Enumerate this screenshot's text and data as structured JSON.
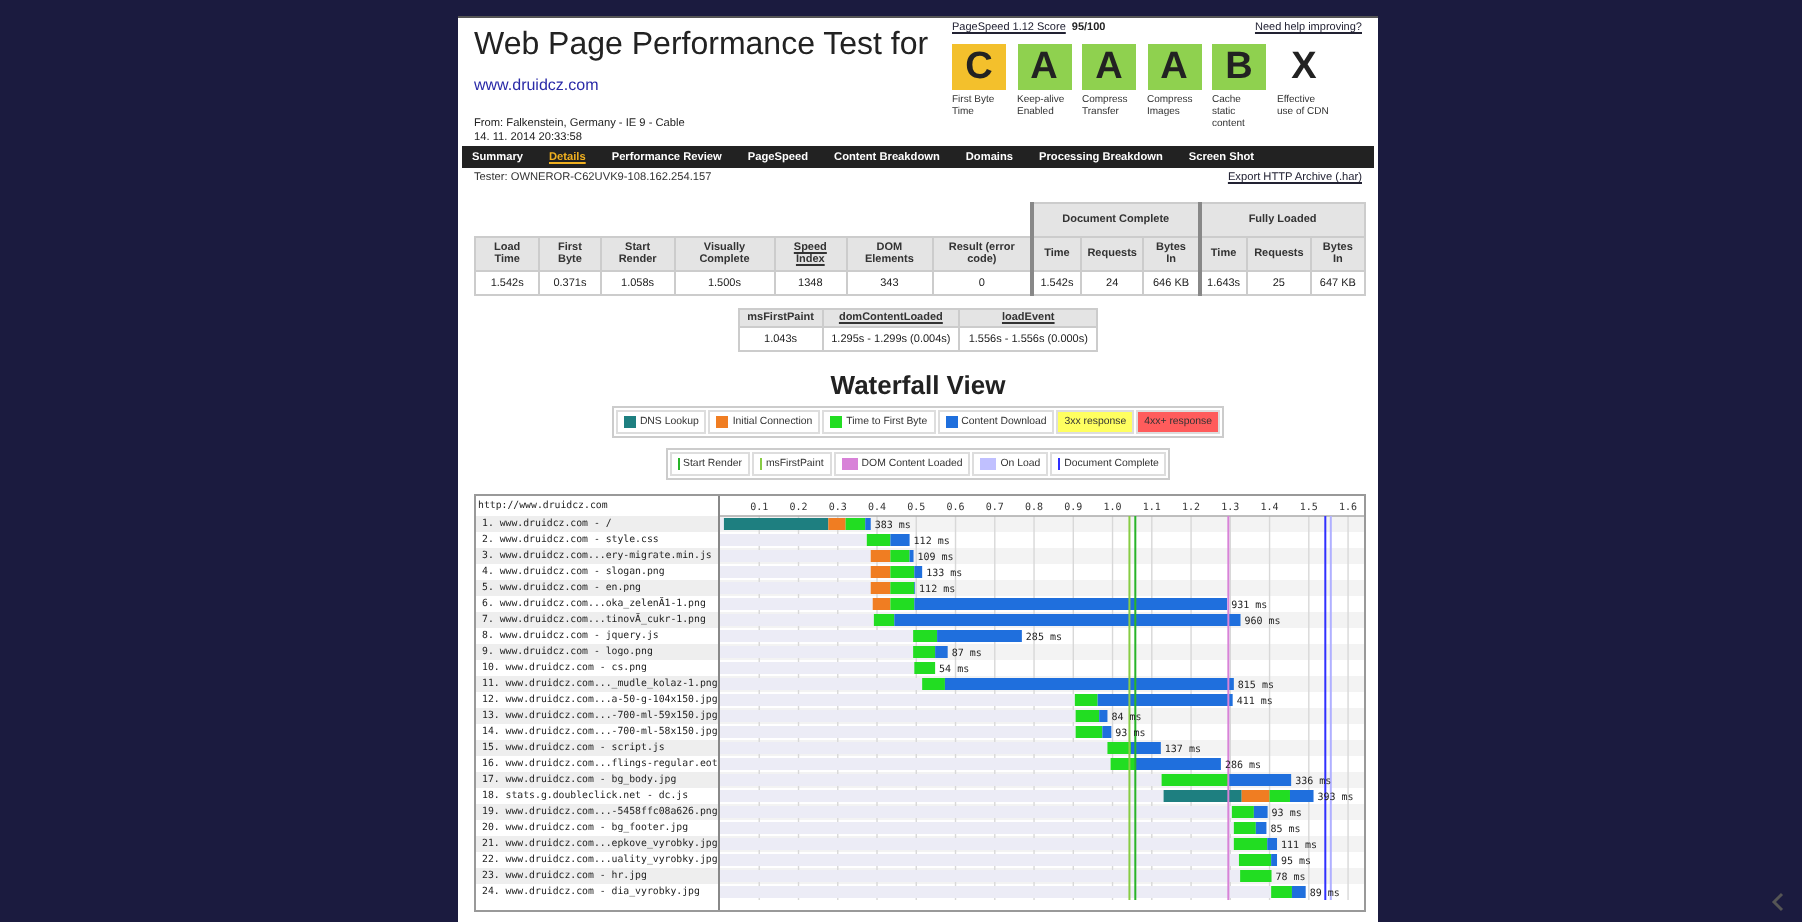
{
  "header": {
    "title": "Web Page Performance Test for",
    "url": "www.druidcz.com",
    "from": "From: Falkenstein, Germany - IE 9 - Cable",
    "date": "14. 11. 2014 20:33:58",
    "pagespeed_link": "PageSpeed 1.12 Score",
    "pagespeed_score": "95/100",
    "help_link": "Need help improving?"
  },
  "grades": [
    {
      "grade": "C",
      "label": "First Byte Time",
      "color": "#f3c02c"
    },
    {
      "grade": "A",
      "label": "Keep-alive Enabled",
      "color": "#8fd14f"
    },
    {
      "grade": "A",
      "label": "Compress Transfer",
      "color": "#8fd14f"
    },
    {
      "grade": "A",
      "label": "Compress Images",
      "color": "#8fd14f"
    },
    {
      "grade": "B",
      "label": "Cache static content",
      "color": "#8fd14f"
    },
    {
      "grade": "X",
      "label": "Effective use of CDN",
      "color": "#ffffff"
    }
  ],
  "nav": [
    {
      "label": "Summary",
      "selected": false
    },
    {
      "label": "Details",
      "selected": true
    },
    {
      "label": "Performance Review",
      "selected": false
    },
    {
      "label": "PageSpeed",
      "selected": false
    },
    {
      "label": "Content Breakdown",
      "selected": false
    },
    {
      "label": "Domains",
      "selected": false
    },
    {
      "label": "Processing Breakdown",
      "selected": false
    },
    {
      "label": "Screen Shot",
      "selected": false
    }
  ],
  "tester": "Tester: OWNEROR-C62UVK9-108.162.254.157",
  "export_link": "Export HTTP Archive (.har)",
  "summary_table": {
    "columns": [
      {
        "label": "Load Time",
        "link": false
      },
      {
        "label": "First Byte",
        "link": false
      },
      {
        "label": "Start Render",
        "link": false
      },
      {
        "label": "Visually Complete",
        "link": false
      },
      {
        "label": "Speed Index",
        "link": true
      },
      {
        "label": "DOM Elements",
        "link": false
      },
      {
        "label": "Result (error code)",
        "link": false
      }
    ],
    "groups": [
      {
        "label": "Document Complete",
        "columns": [
          "Time",
          "Requests",
          "Bytes In"
        ]
      },
      {
        "label": "Fully Loaded",
        "columns": [
          "Time",
          "Requests",
          "Bytes In"
        ]
      }
    ],
    "row": [
      "1.542s",
      "0.371s",
      "1.058s",
      "1.500s",
      "1348",
      "343",
      "0",
      "1.542s",
      "24",
      "646 KB",
      "1.643s",
      "25",
      "647 KB"
    ]
  },
  "timing_table": {
    "columns": [
      {
        "label": "msFirstPaint",
        "link": false
      },
      {
        "label": "domContentLoaded",
        "link": true
      },
      {
        "label": "loadEvent",
        "link": true
      }
    ],
    "row": [
      "1.043s",
      "1.295s - 1.299s (0.004s)",
      "1.556s - 1.556s (0.000s)"
    ]
  },
  "waterfall": {
    "title": "Waterfall View",
    "legend": [
      {
        "label": "3xx response",
        "color": "#ffff60"
      },
      {
        "label": "4xx+ response",
        "color": "#ff5c5c"
      }
    ],
    "markers": [
      {
        "label": "Start Render",
        "color": "#28b428",
        "kind": "line"
      },
      {
        "label": "msFirstPaint",
        "color": "#88cc44",
        "kind": "line"
      },
      {
        "label": "DOM Content Loaded",
        "color": "#d882d8",
        "kind": "box"
      },
      {
        "label": "On Load",
        "color": "#c0c0ff",
        "kind": "box"
      },
      {
        "label": "Document Complete",
        "color": "#3030ff",
        "kind": "line"
      }
    ],
    "header": "http://www.druidcz.com",
    "chart_data": {
      "type": "bar",
      "orientation": "horizontal",
      "stacked": true,
      "categories": [
        "1. www.druidcz.com - /",
        "2. www.druidcz.com - style.css",
        "3. www.druidcz.com...ery-migrate.min.js",
        "4. www.druidcz.com - slogan.png",
        "5. www.druidcz.com - en.png",
        "6. www.druidcz.com...oka_zelenÃ1-1.png",
        "7. www.druidcz.com...tinovÃ_cukr-1.png",
        "8. www.druidcz.com - jquery.js",
        "9. www.druidcz.com - logo.png",
        "10. www.druidcz.com - cs.png",
        "11. www.druidcz.com..._mudle_kolaz-1.png",
        "12. www.druidcz.com...a-50-g-104x150.jpg",
        "13. www.druidcz.com...-700-ml-59x150.jpg",
        "14. www.druidcz.com...-700-ml-58x150.jpg",
        "15. www.druidcz.com - script.js",
        "16. www.druidcz.com...flings-regular.eot",
        "17. www.druidcz.com - bg_body.jpg",
        "18. stats.g.doubleclick.net - dc.js",
        "19. www.druidcz.com...-5458ffc08a626.png",
        "20. www.druidcz.com - bg_footer.jpg",
        "21. www.druidcz.com...epkove_vyrobky.jpg",
        "22. www.druidcz.com...uality_vyrobky.jpg",
        "23. www.druidcz.com - hr.jpg",
        "24. www.druidcz.com - dia_vyrobky.jpg"
      ],
      "series": [
        {
          "color": "#ececf6",
          "values": [
            0.01,
            0.374,
            0.384,
            0.384,
            0.384,
            0.389,
            0.392,
            0.492,
            0.492,
            0.495,
            0.515,
            0.904,
            0.906,
            0.906,
            0.987,
            0.995,
            1.125,
            1.13,
            1.304,
            1.309,
            1.309,
            1.322,
            1.325,
            1.404
          ]
        },
        {
          "name": "DNS Lookup",
          "color": "#1e7f80",
          "values": [
            0.266,
            0,
            0,
            0,
            0,
            0,
            0,
            0,
            0,
            0,
            0,
            0,
            0,
            0,
            0,
            0,
            0,
            0.199,
            0,
            0,
            0,
            0,
            0,
            0
          ]
        },
        {
          "name": "Initial Connection",
          "color": "#f07d22",
          "values": [
            0.044,
            0,
            0.05,
            0.05,
            0.05,
            0.045,
            0,
            0,
            0,
            0,
            0,
            0,
            0,
            0,
            0,
            0,
            0,
            0.071,
            0,
            0,
            0,
            0,
            0,
            0
          ]
        },
        {
          "name": "Time to First Byte",
          "color": "#22dd22",
          "values": [
            0.05,
            0.06,
            0.049,
            0.061,
            0.061,
            0.061,
            0.052,
            0.061,
            0.056,
            0.053,
            0.058,
            0.058,
            0.06,
            0.068,
            0.06,
            0.062,
            0.169,
            0.052,
            0.056,
            0.056,
            0.085,
            0.082,
            0.08,
            0.053
          ]
        },
        {
          "name": "Content Download",
          "color": "#1f6fdd",
          "values": [
            0.014,
            0.049,
            0.01,
            0.02,
            0.002,
            0.797,
            0.882,
            0.216,
            0.032,
            0,
            0.736,
            0.344,
            0.021,
            0.023,
            0.076,
            0.219,
            0.161,
            0.06,
            0.035,
            0.027,
            0.025,
            0.015,
            0,
            0.035
          ]
        }
      ],
      "value_labels": [
        "383 ms",
        "112 ms",
        "109 ms",
        "133 ms",
        "112 ms",
        "931 ms",
        "960 ms",
        "285 ms",
        "87 ms",
        "54 ms",
        "815 ms",
        "411 ms",
        "84 ms",
        "93 ms",
        "137 ms",
        "286 ms",
        "336 ms",
        "393 ms",
        "93 ms",
        "85 ms",
        "111 ms",
        "95 ms",
        "78 ms",
        "89 ms"
      ],
      "xlim": [
        0,
        1.61
      ],
      "xticks": [
        0.1,
        0.2,
        0.3,
        0.4,
        0.5,
        0.6,
        0.7,
        0.8,
        0.9,
        {
          "value": 1,
          "label": "1.0"
        },
        1.1,
        1.2,
        1.3,
        1.4,
        1.5,
        1.6
      ],
      "grid": true,
      "ref_lines": [
        {
          "axis": "x",
          "value": 1.043,
          "color": "#88cc44"
        },
        {
          "axis": "x",
          "value": 1.058,
          "color": "#28b428"
        },
        {
          "axis": "x",
          "value": 1.295,
          "color": "#d882d8"
        },
        {
          "axis": "x",
          "value": 1.542,
          "color": "#3030ff"
        },
        {
          "axis": "x",
          "value": 1.556,
          "color": "#b0b0ff"
        }
      ]
    }
  }
}
